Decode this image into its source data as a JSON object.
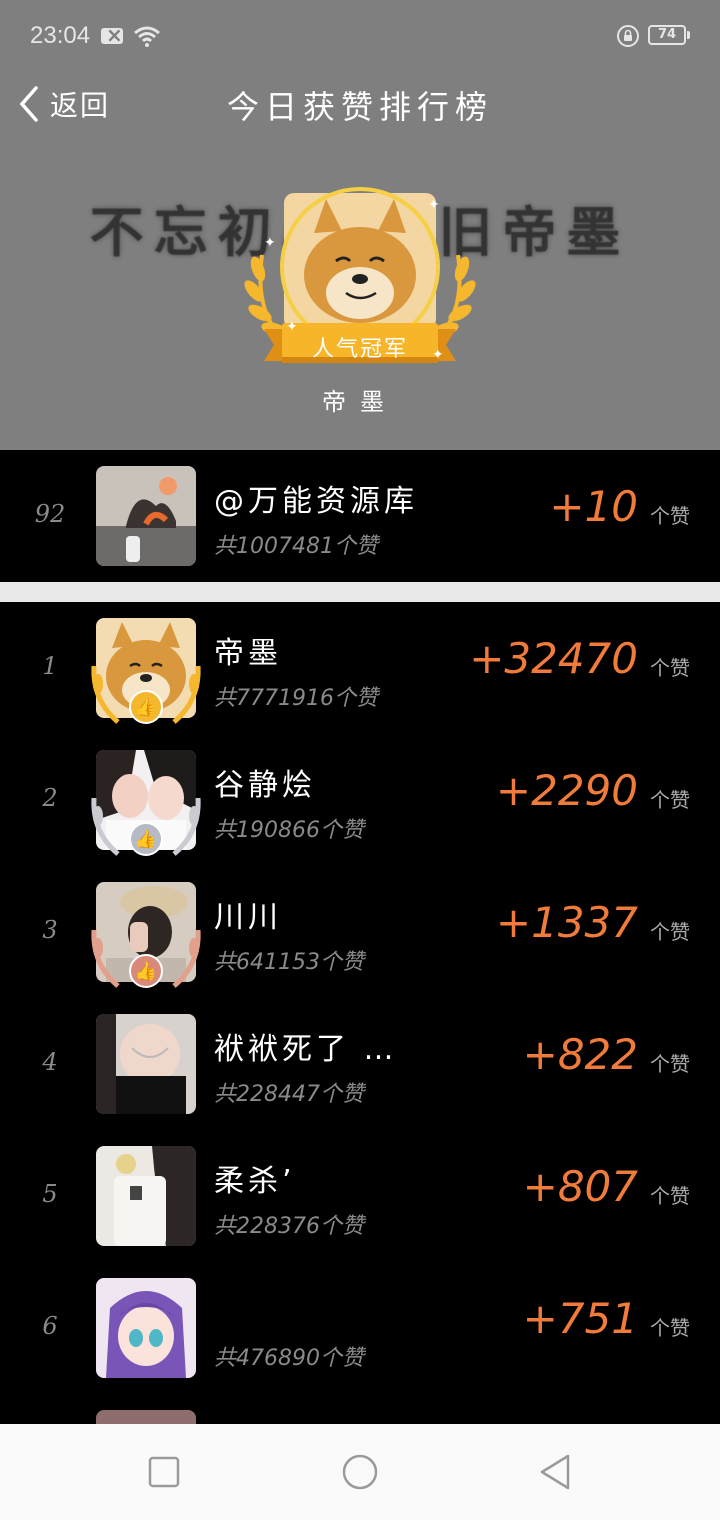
{
  "status_bar": {
    "time": "23:04",
    "battery": "74"
  },
  "header": {
    "back_label": "返回",
    "title": "今日获赞排行榜",
    "banner_text": "不忘初心 依旧帝墨",
    "champion": {
      "ribbon": "人气冠军",
      "name": "帝墨"
    }
  },
  "self": {
    "rank": "92",
    "name": "@万能资源库",
    "total": "共1007481个赞",
    "likes": "+10",
    "unit": "个赞"
  },
  "ranking": [
    {
      "rank": "1",
      "name": "帝墨",
      "total": "共7771916个赞",
      "likes": "+32470",
      "unit": "个赞"
    },
    {
      "rank": "2",
      "name": "谷静烩",
      "total": "共190866个赞",
      "likes": "+2290",
      "unit": "个赞"
    },
    {
      "rank": "3",
      "name": "川川",
      "total": "共641153个赞",
      "likes": "+1337",
      "unit": "个赞"
    },
    {
      "rank": "4",
      "name": "袱袱死了 …",
      "total": "共228447个赞",
      "likes": "+822",
      "unit": "个赞"
    },
    {
      "rank": "5",
      "name": "柔杀’",
      "total": "共228376个赞",
      "likes": "+807",
      "unit": "个赞"
    },
    {
      "rank": "6",
      "name": "",
      "total": "共476890个赞",
      "likes": "+751",
      "unit": "个赞"
    }
  ],
  "colors": {
    "header_bg": "#7f7f7f",
    "accent_likes": "#f07b3a",
    "gold": "#f5b72d",
    "silver": "#c9cbd1",
    "bronze": "#e2a08c"
  }
}
